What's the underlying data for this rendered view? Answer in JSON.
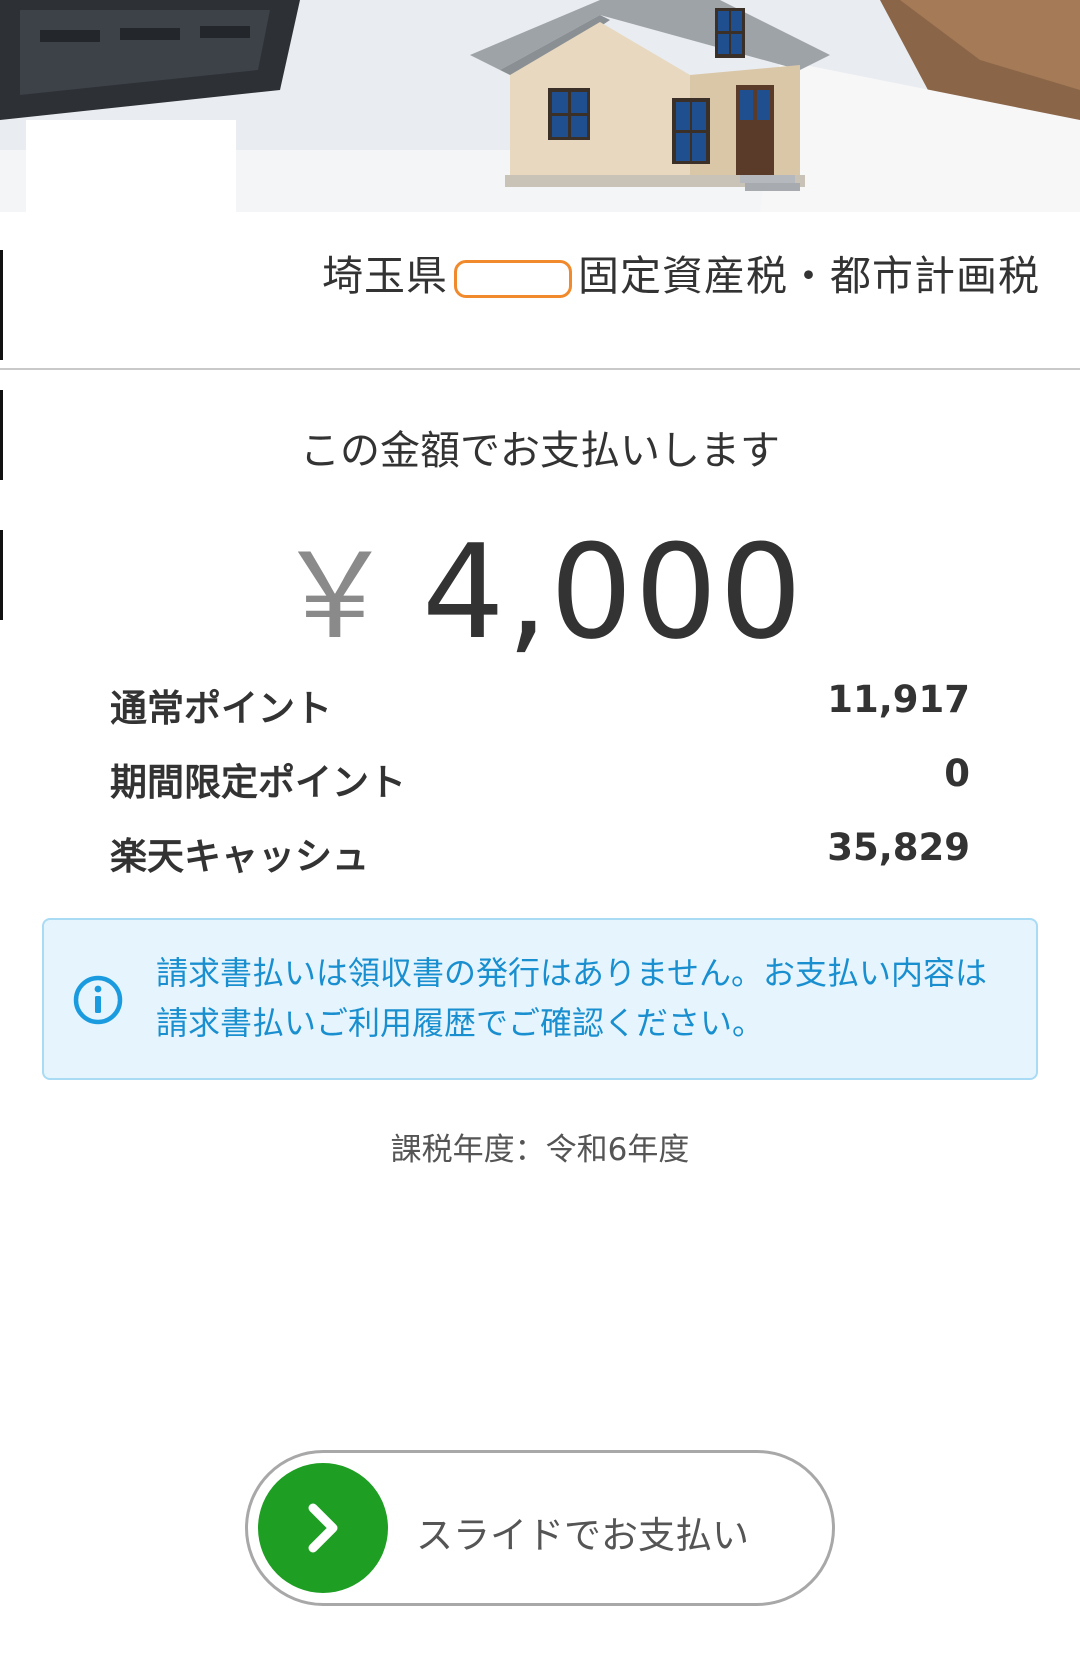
{
  "header": {
    "banner_image": "house-model-photo",
    "biller_prefix": "埼玉県",
    "biller_suffix": "固定資産税・都市計画税"
  },
  "payment": {
    "caption": "この金額でお支払いします",
    "currency_symbol": "￥",
    "amount": "4,000"
  },
  "points": [
    {
      "label": "通常ポイント",
      "value": "11,917"
    },
    {
      "label": "期間限定ポイント",
      "value": "0"
    },
    {
      "label": "楽天キャッシュ",
      "value": "35,829"
    }
  ],
  "notice": {
    "icon": "info-icon",
    "text": "請求書払いは領収書の発行はありません。お支払い内容は請求書払いご利用履歴でご確認ください。"
  },
  "tax_year": "課税年度：令和6年度",
  "slider": {
    "label": "スライドでお支払い",
    "knob_icon": "chevron-right-icon"
  },
  "colors": {
    "accent_green": "#1e9e22",
    "notice_bg": "#e6f5fd",
    "notice_text": "#1a8fd0",
    "redaction_outline": "#f08a2c"
  }
}
